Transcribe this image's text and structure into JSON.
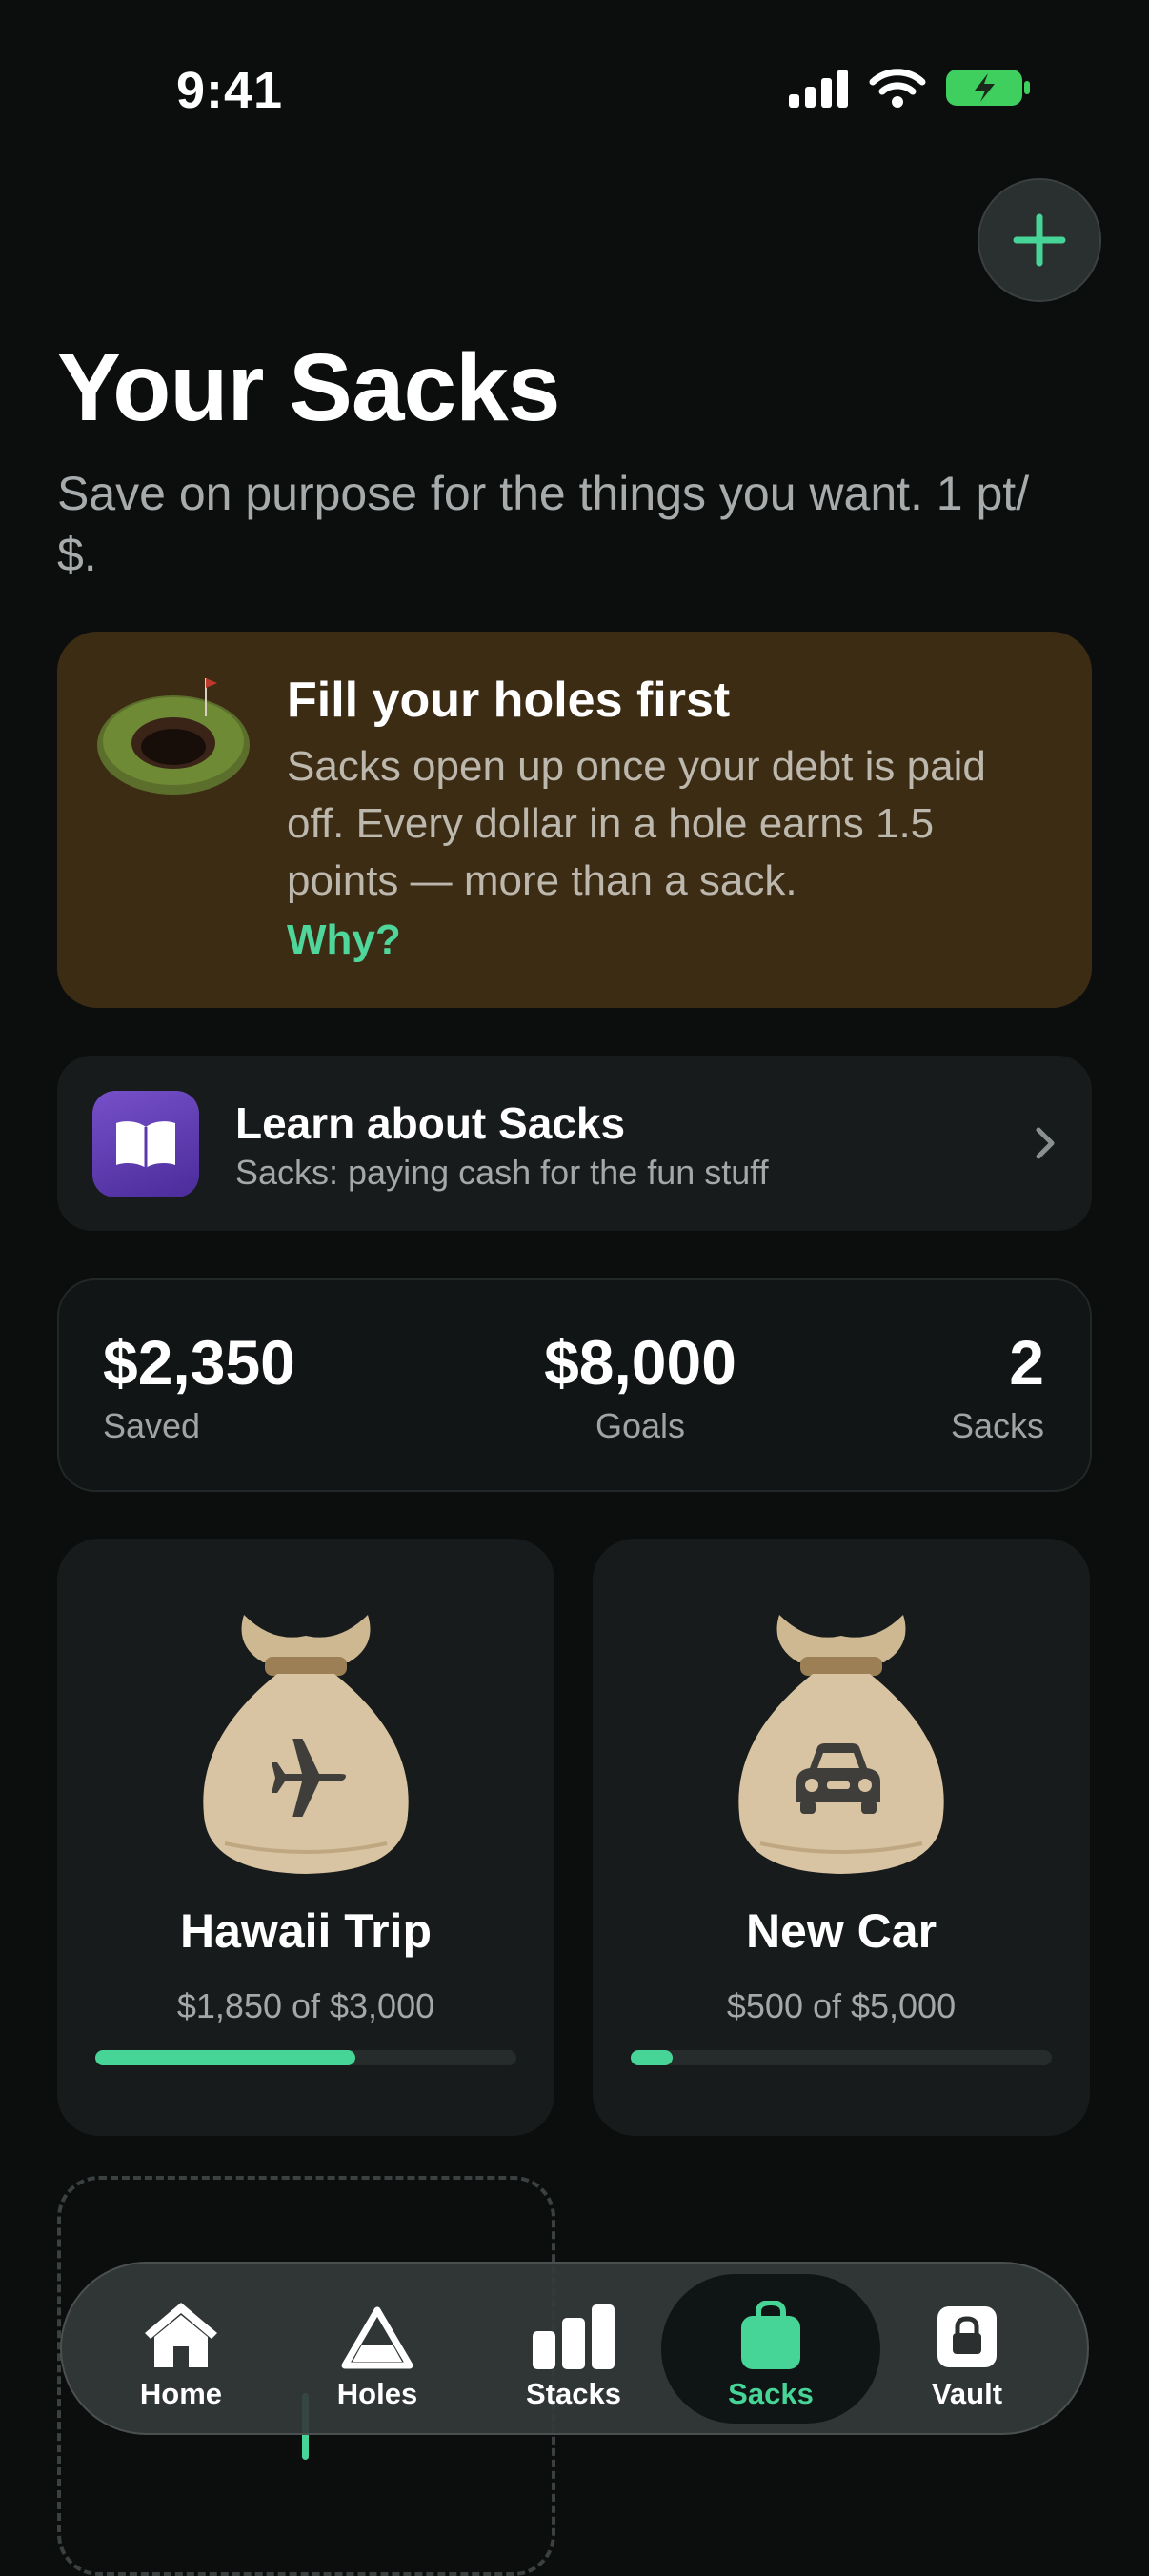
{
  "status": {
    "time": "9:41"
  },
  "header": {
    "title": "Your Sacks",
    "subtitle": "Save on purpose for the things you want. 1 pt/ $."
  },
  "notice": {
    "title": "Fill your holes first",
    "body": "Sacks open up once your debt is paid off. Every dollar in a hole earns 1.5 points — more than a sack.",
    "link": "Why?"
  },
  "learn": {
    "title": "Learn about Sacks",
    "subtitle": "Sacks: paying cash for the fun stuff"
  },
  "stats": [
    {
      "value": "$2,350",
      "label": "Saved"
    },
    {
      "value": "$8,000",
      "label": "Goals"
    },
    {
      "value": "2",
      "label": "Sacks"
    }
  ],
  "sacks": [
    {
      "name": "Hawaii Trip",
      "amount": "$1,850 of $3,000",
      "progress": 0.617,
      "icon": "airplane-icon"
    },
    {
      "name": "New Car",
      "amount": "$500 of $5,000",
      "progress": 0.1,
      "icon": "car-icon"
    }
  ],
  "tabs": [
    {
      "label": "Home",
      "icon": "house-icon",
      "active": false
    },
    {
      "label": "Holes",
      "icon": "triangle-icon",
      "active": false
    },
    {
      "label": "Stacks",
      "icon": "bar-chart-icon",
      "active": false
    },
    {
      "label": "Sacks",
      "icon": "bag-icon",
      "active": true
    },
    {
      "label": "Vault",
      "icon": "lock-icon",
      "active": false
    }
  ],
  "colors": {
    "accent": "#46d497",
    "background": "#0c0e0e",
    "notice_bg": "#3d2c14",
    "battery": "#3fcf5f"
  }
}
